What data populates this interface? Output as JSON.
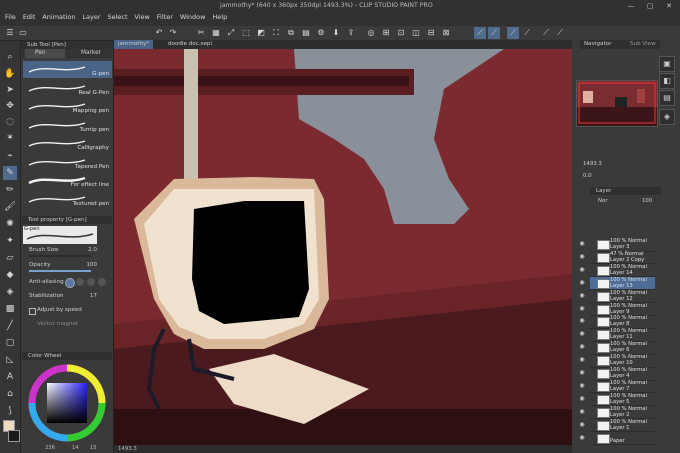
{
  "window": {
    "title": "jammothy* (640 x 360px 350dpi 1493.3%)  - CLIP STUDIO PAINT PRO",
    "controls": [
      "—",
      "▢",
      "✕"
    ]
  },
  "menu": [
    "File",
    "Edit",
    "Animation",
    "Layer",
    "Select",
    "View",
    "Filter",
    "Window",
    "Help"
  ],
  "tabs": {
    "active": "jammothy*",
    "other": "doodle doc.sepi"
  },
  "subtool": {
    "title": "Sub Tool [Pen]",
    "tab_pen": "Pen",
    "tab_marker": "Marker",
    "brushes": [
      "G-pen",
      "Real G-Pen",
      "Mapping pen",
      "Turnip pen",
      "Calligraphy",
      "Tapered Pen",
      "For effect line",
      "Textured pen"
    ],
    "selected_index": 0
  },
  "tool_property": {
    "title": "Tool property [G-pen]",
    "preview_label": "G-pen",
    "brush_size_label": "Brush Size",
    "brush_size_value": "2.0",
    "opacity_label": "Opacity",
    "opacity_value": "100",
    "anti_aliasing_label": "Anti-aliasing",
    "stabilization_label": "Stabilization",
    "stabilization_value": "17",
    "adjust_speed_label": "Adjust by speed",
    "vector_magnet_label": "Vector magnet"
  },
  "color_wheel": {
    "title": "Color Wheel",
    "values": [
      "236",
      "14",
      "15"
    ],
    "main_color": "#eddcc0",
    "sub_color": "#1a1a1a"
  },
  "status": {
    "zoom": "1493.3"
  },
  "navigator": {
    "tab1": "Navigator",
    "tab2": "Sub View",
    "zoom": "1493.3",
    "angle": "0.0"
  },
  "layer_panel": {
    "title": "Layer",
    "blend_mode": "Nor",
    "opacity": "100",
    "layers": [
      {
        "top": "100 % Normal",
        "name": "Layer 3"
      },
      {
        "top": "47 % Normal",
        "name": "Layer 2 Copy"
      },
      {
        "top": "100 % Normal",
        "name": "Layer 14"
      },
      {
        "top": "100 % Normal",
        "name": "Layer 13",
        "selected": true
      },
      {
        "top": "100 % Normal",
        "name": "Layer 12"
      },
      {
        "top": "100 % Normal",
        "name": "Layer 9"
      },
      {
        "top": "100 % Normal",
        "name": "Layer 8"
      },
      {
        "top": "100 % Normal",
        "name": "Layer 11"
      },
      {
        "top": "100 % Normal",
        "name": "Layer 6"
      },
      {
        "top": "100 % Normal",
        "name": "Layer 10"
      },
      {
        "top": "100 % Normal",
        "name": "Layer 4"
      },
      {
        "top": "100 % Normal",
        "name": "Layer 7"
      },
      {
        "top": "100 % Normal",
        "name": "Layer 5"
      },
      {
        "top": "100 % Normal",
        "name": "Layer 2"
      },
      {
        "top": "100 % Normal",
        "name": "Layer 1"
      },
      {
        "top": "",
        "name": "Paper"
      }
    ]
  },
  "accent": "#4d6c96"
}
